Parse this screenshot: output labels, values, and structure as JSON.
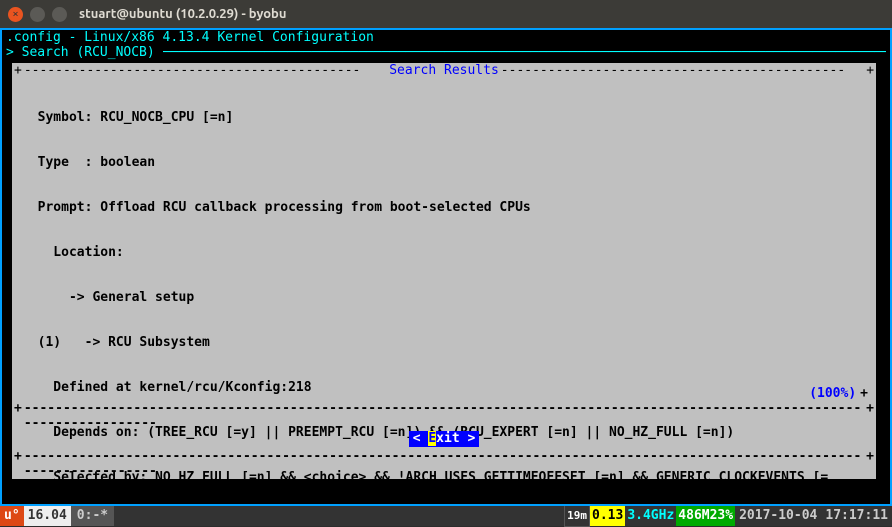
{
  "window": {
    "title": "stuart@ubuntu (10.2.0.29) - byobu"
  },
  "header": {
    "line1": ".config - Linux/x86 4.13.4 Kernel Configuration",
    "line2_prefix": "> Search (RCU_NOCB) "
  },
  "dialog": {
    "title": "Search Results",
    "lines": {
      "l1": "  Symbol: RCU_NOCB_CPU [=n]",
      "l2": "  Type  : boolean",
      "l3": "  Prompt: Offload RCU callback processing from boot-selected CPUs",
      "l4": "    Location:",
      "l5": "      -> General setup",
      "l6": "  (1)   -> RCU Subsystem",
      "l7": "    Defined at kernel/rcu/Kconfig:218",
      "l8": "    Depends on: (TREE_RCU [=y] || PREEMPT_RCU [=n]) && (RCU_EXPERT [=n] || NO_HZ_FULL [=n])",
      "l9": "    Selected by: NO_HZ_FULL [=n] && <choice> && !ARCH_USES_GETTIMEOFFSET [=n] && GENERIC_CLOCKEVENTS [="
    },
    "percent": "(100%)",
    "exit_pre": "< ",
    "exit_e": "E",
    "exit_post": "xit >"
  },
  "status": {
    "u": "u°",
    "version": "16.04",
    "session": "0:-*",
    "uptime": "19m",
    "load": "0.13",
    "freq": "3.4GHz",
    "mem": "486M23%",
    "date": "2017-10-04",
    "time": "17:17:11"
  }
}
